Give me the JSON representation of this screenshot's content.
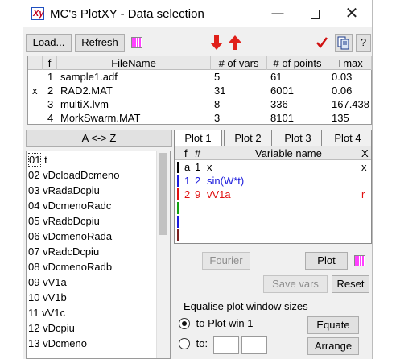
{
  "window": {
    "title": "MC's PlotXY - Data selection",
    "app_icon_glyph": "Xy",
    "minimize_glyph": "—",
    "close_glyph": "✕"
  },
  "toolbar": {
    "load_label": "Load...",
    "refresh_label": "Refresh",
    "help_label": "?",
    "accent_colors": {
      "arrow_red": "#e0201a",
      "check_red": "#d01010",
      "swatch_magenta": "#ff40ff"
    }
  },
  "file_table": {
    "columns": [
      "",
      "f",
      "FileName",
      "# of vars",
      "# of points",
      "Tmax"
    ],
    "rows": [
      {
        "mark": "",
        "f": "1",
        "name": "sample1.adf",
        "vars": "5",
        "points": "61",
        "tmax": "0.03"
      },
      {
        "mark": "x",
        "f": "2",
        "name": "RAD2.MAT",
        "vars": "31",
        "points": "6001",
        "tmax": "0.06"
      },
      {
        "mark": "",
        "f": "3",
        "name": "multiX.lvm",
        "vars": "8",
        "points": "336",
        "tmax": "167.438"
      },
      {
        "mark": "",
        "f": "4",
        "name": "MorkSwarm.MAT",
        "vars": "3",
        "points": "8101",
        "tmax": "135"
      }
    ]
  },
  "sort_button_label": "A <-> Z",
  "variable_list": {
    "items": [
      {
        "num": "01",
        "name": "t"
      },
      {
        "num": "02",
        "name": "vDcloadDcmeno"
      },
      {
        "num": "03",
        "name": "vRadaDcpiu"
      },
      {
        "num": "04",
        "name": "vDcmenoRadc"
      },
      {
        "num": "05",
        "name": "vRadbDcpiu"
      },
      {
        "num": "06",
        "name": "vDcmenoRada"
      },
      {
        "num": "07",
        "name": "vRadcDcpiu"
      },
      {
        "num": "08",
        "name": "vDcmenoRadb"
      },
      {
        "num": "09",
        "name": "vV1a"
      },
      {
        "num": "10",
        "name": "vV1b"
      },
      {
        "num": "11",
        "name": "vV1c"
      },
      {
        "num": "12",
        "name": "vDcpiu"
      },
      {
        "num": "13",
        "name": "vDcmeno"
      }
    ]
  },
  "plot_tabs": [
    "Plot 1",
    "Plot 2",
    "Plot 3",
    "Plot 4"
  ],
  "plot_vars": {
    "columns": [
      "f",
      "#",
      "Variable name",
      "X"
    ],
    "rows": [
      {
        "f": "a",
        "n": "1",
        "name": "x",
        "flag": "x",
        "color": "#000000"
      },
      {
        "f": "1",
        "n": "2",
        "name": "sin(W*t)",
        "flag": "",
        "color": "#1a1adc"
      },
      {
        "f": "2",
        "n": "9",
        "name": "vV1a",
        "flag": "r",
        "color": "#e01010"
      }
    ],
    "empty_row_colors": [
      "#10a010",
      "#1a1adc",
      "#7a2020"
    ]
  },
  "buttons": {
    "fourier": "Fourier",
    "plot": "Plot",
    "save_vars": "Save vars",
    "reset": "Reset",
    "equate": "Equate",
    "arrange": "Arrange"
  },
  "equalise": {
    "title": "Equalise plot window sizes",
    "option1": "to Plot win 1",
    "option2": "to:",
    "selected": "option1"
  }
}
